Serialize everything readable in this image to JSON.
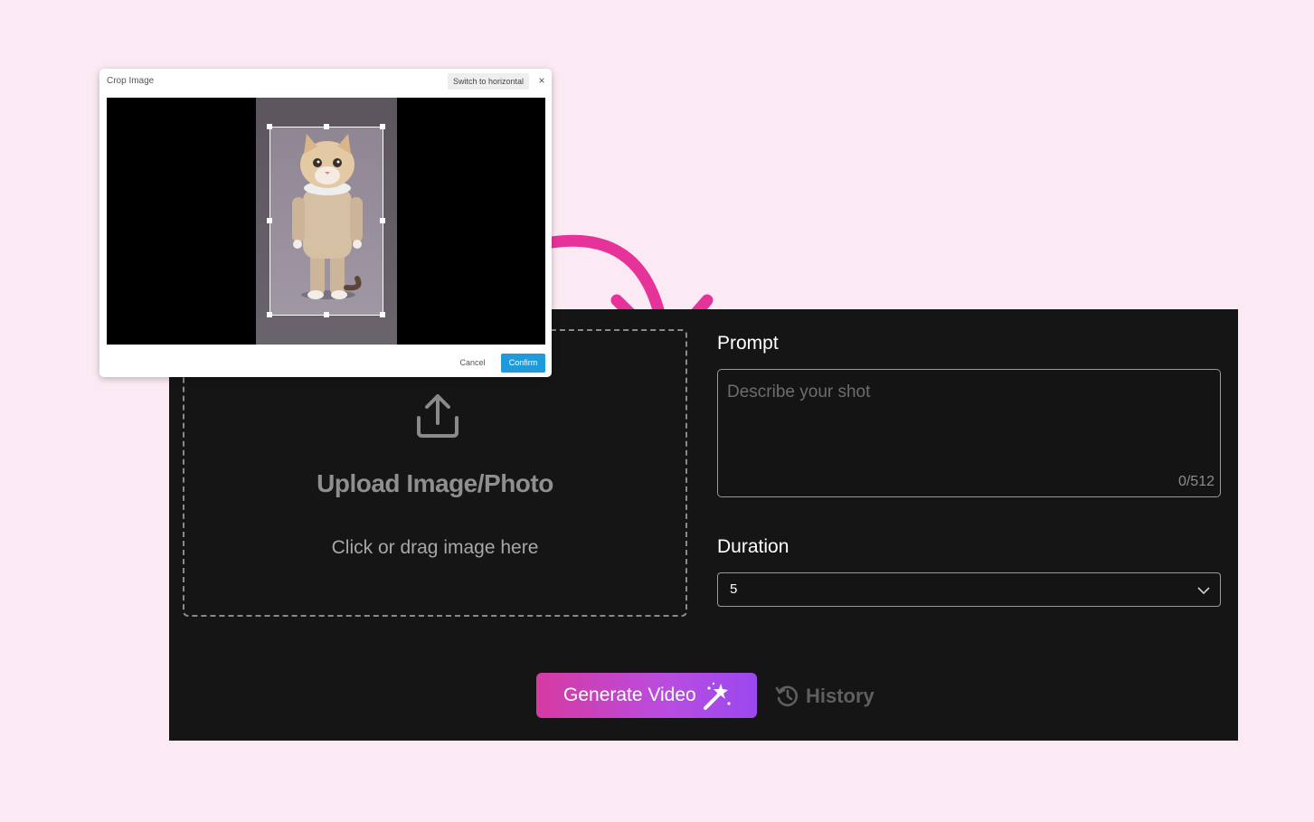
{
  "colors": {
    "page_background": "#fbeaf3",
    "panel_background": "#151515",
    "arrow": "#e6339a",
    "confirm_button": "#1f9bdc",
    "generate_gradient_start": "#d63aa2",
    "generate_gradient_end": "#9b48f0"
  },
  "crop_dialog": {
    "title": "Crop Image",
    "switch_label": "Switch to horizontal",
    "close_symbol": "×",
    "cancel_label": "Cancel",
    "confirm_label": "Confirm",
    "image_description_icon": "cat-in-sweater-photo"
  },
  "upload": {
    "icon": "upload-icon",
    "title": "Upload Image/Photo",
    "hint": "Click or drag image here"
  },
  "prompt": {
    "label": "Prompt",
    "placeholder": "Describe your shot",
    "counter": "0/512"
  },
  "duration": {
    "label": "Duration",
    "selected": "5",
    "icon": "chevron-down-icon"
  },
  "actions": {
    "generate_label": "Generate Video",
    "generate_icon": "magic-wand-icon",
    "history_label": "History",
    "history_icon": "history-icon"
  }
}
